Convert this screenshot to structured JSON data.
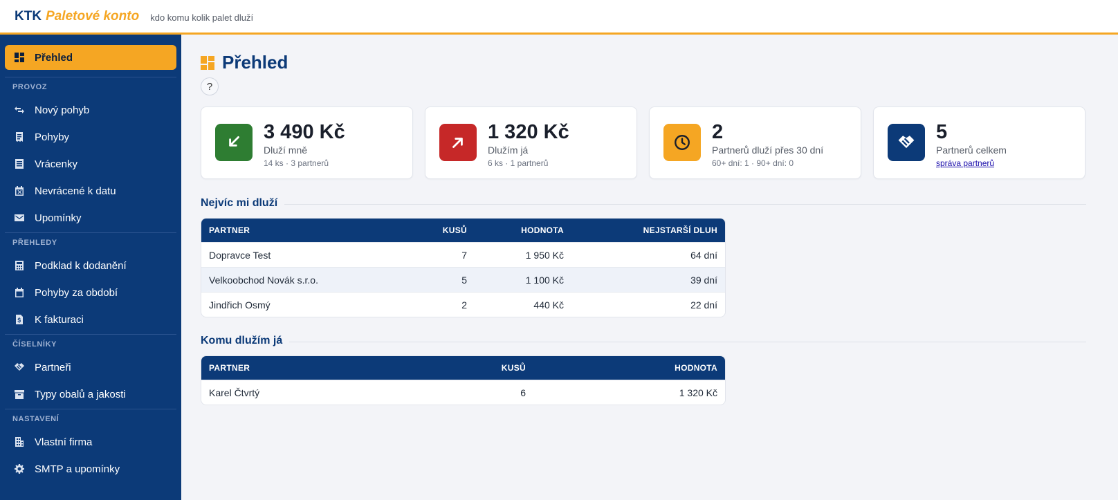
{
  "header": {
    "brand_short": "KTK",
    "brand_name": "Paletové konto",
    "tagline": "kdo komu kolik palet dluží"
  },
  "sidebar": {
    "active": {
      "label": "Přehled",
      "icon": "dashboard-icon"
    },
    "sections": [
      {
        "title": "PROVOZ",
        "items": [
          {
            "label": "Nový pohyb",
            "icon": "swap-icon"
          },
          {
            "label": "Pohyby",
            "icon": "receipt-icon"
          },
          {
            "label": "Vrácenky",
            "icon": "list-icon"
          },
          {
            "label": "Nevrácené k datu",
            "icon": "calendar-x-icon"
          },
          {
            "label": "Upomínky",
            "icon": "mail-icon"
          }
        ]
      },
      {
        "title": "PŘEHLEDY",
        "items": [
          {
            "label": "Podklad k dodanění",
            "icon": "calculator-icon"
          },
          {
            "label": "Pohyby za období",
            "icon": "calendar-icon"
          },
          {
            "label": "K fakturaci",
            "icon": "invoice-icon"
          }
        ]
      },
      {
        "title": "ČÍSELNÍKY",
        "items": [
          {
            "label": "Partneři",
            "icon": "handshake-icon"
          },
          {
            "label": "Typy obalů a jakosti",
            "icon": "archive-icon"
          }
        ]
      },
      {
        "title": "NASTAVENÍ",
        "items": [
          {
            "label": "Vlastní firma",
            "icon": "building-icon"
          },
          {
            "label": "SMTP a upomínky",
            "icon": "gear-icon"
          }
        ]
      }
    ]
  },
  "page": {
    "title": "Přehled",
    "help_label": "?"
  },
  "cards": [
    {
      "value": "3 490 Kč",
      "label": "Dluží mně",
      "sub": "14 ks · 3 partnerů",
      "color": "#2e7d32",
      "icon": "arrow-down-left-icon"
    },
    {
      "value": "1 320 Kč",
      "label": "Dlužím já",
      "sub": "6 ks · 1 partnerů",
      "color": "#c62828",
      "icon": "arrow-up-right-icon"
    },
    {
      "value": "2",
      "label": "Partnerů dluží přes 30 dní",
      "sub": "60+ dní: 1 · 90+ dní: 0",
      "color": "#f5a623",
      "icon": "clock-icon"
    },
    {
      "value": "5",
      "label": "Partnerů celkem",
      "link": "správa partnerů",
      "color": "#0c3a78",
      "icon": "handshake-icon"
    }
  ],
  "owed_to_me": {
    "title": "Nejvíc mi dluží",
    "columns": [
      "PARTNER",
      "KUSŮ",
      "HODNOTA",
      "NEJSTARŠÍ DLUH"
    ],
    "rows": [
      [
        "Dopravce Test",
        "7",
        "1 950 Kč",
        "64 dní"
      ],
      [
        "Velkoobchod Novák s.r.o.",
        "5",
        "1 100 Kč",
        "39 dní"
      ],
      [
        "Jindřich Osmý",
        "2",
        "440 Kč",
        "22 dní"
      ]
    ]
  },
  "i_owe": {
    "title": "Komu dlužím já",
    "columns": [
      "PARTNER",
      "KUSŮ",
      "HODNOTA"
    ],
    "rows": [
      [
        "Karel Čtvrtý",
        "6",
        "1 320 Kč"
      ]
    ]
  },
  "colors": {
    "brand_blue": "#0c3a78",
    "accent_orange": "#f5a623"
  }
}
